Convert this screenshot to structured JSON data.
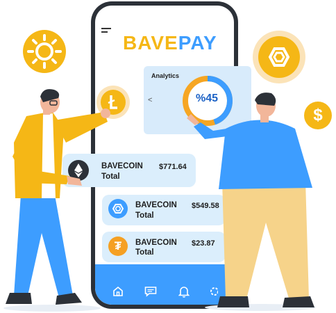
{
  "brand": {
    "part1": "BAVE",
    "part2": "PAY"
  },
  "analytics": {
    "title": "Analytics",
    "value_label": "%45",
    "progress_percent": 45
  },
  "cards": [
    {
      "name": "BAVECOIN",
      "label": "Total",
      "amount": "$771.64",
      "icon": "ethereum-coin-icon"
    },
    {
      "name": "BAVECOIN",
      "label": "Total",
      "amount": "$549.58",
      "icon": "hexagon-coin-icon"
    },
    {
      "name": "BAVECOIN",
      "label": "Total",
      "amount": "$23.87",
      "icon": "tether-coin-icon"
    }
  ],
  "floating_coins": {
    "usd_symbol": "$",
    "tether_symbol": "₮"
  },
  "nav": [
    "home-icon",
    "chat-icon",
    "bell-icon",
    "settings-icon"
  ],
  "colors": {
    "brand_yellow": "#f5b716",
    "brand_blue": "#3d9dff",
    "card_bg": "#dbeefc",
    "analytics_bg": "#d8ebfb",
    "coin_orange": "#f5a023"
  }
}
